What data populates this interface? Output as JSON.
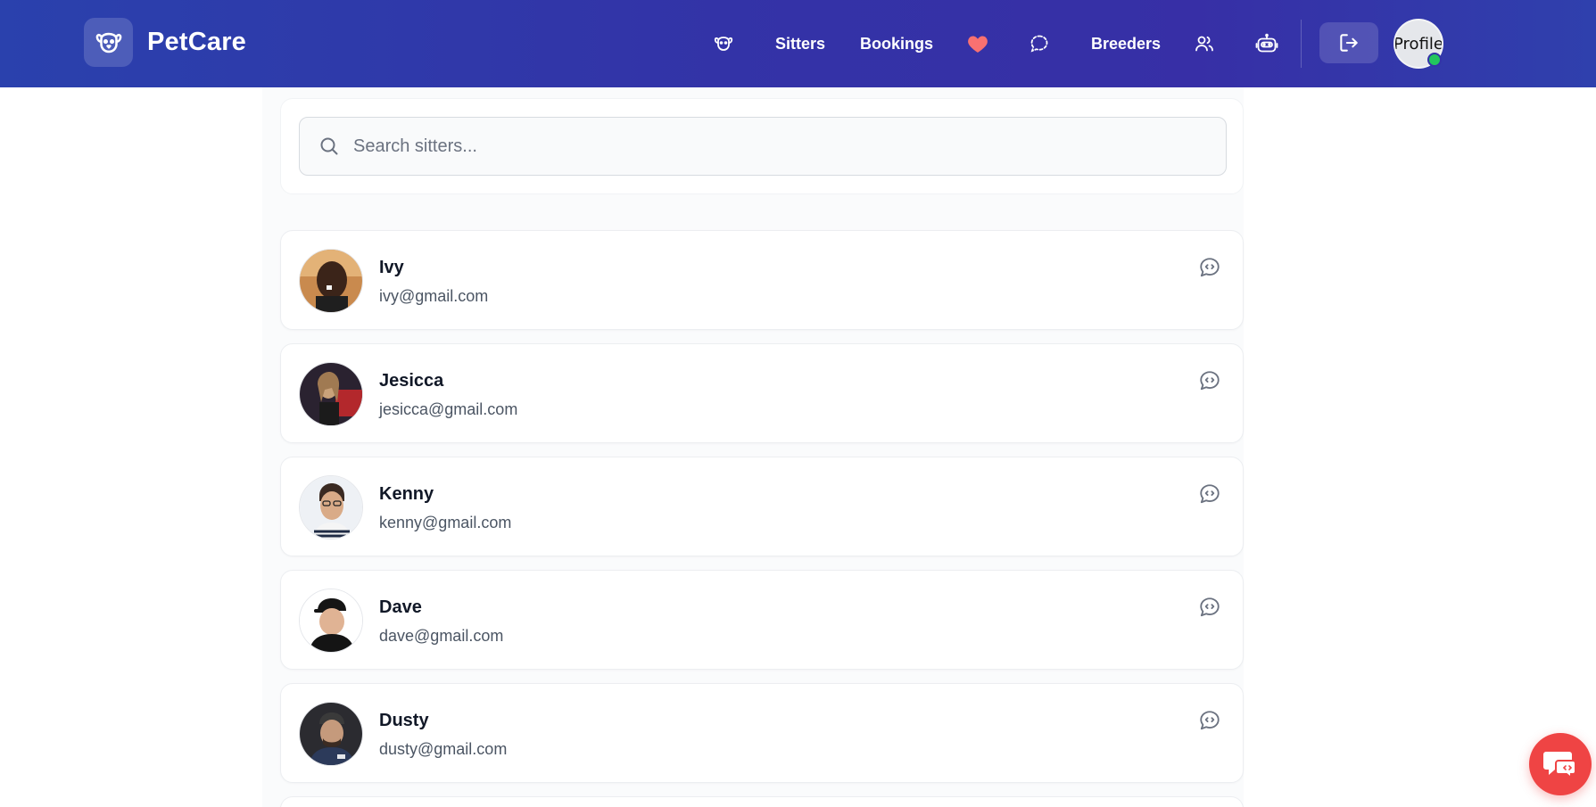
{
  "app": {
    "brand_name": "PetCare"
  },
  "nav": {
    "items": [
      {
        "type": "icon",
        "icon": "pet-face-icon"
      },
      {
        "type": "link",
        "label": "Sitters"
      },
      {
        "type": "link",
        "label": "Bookings"
      },
      {
        "type": "icon",
        "icon": "heart-icon",
        "color": "#f87171"
      },
      {
        "type": "icon",
        "icon": "chat-bubble-dashed-icon"
      },
      {
        "type": "link",
        "label": "Breeders"
      },
      {
        "type": "icon",
        "icon": "users-icon"
      },
      {
        "type": "icon",
        "icon": "robot-icon"
      }
    ],
    "logout_icon": "logout-icon",
    "profile_alt": "Profile",
    "online_status_color": "#22c55e"
  },
  "search": {
    "placeholder": "Search sitters..."
  },
  "sitters": [
    {
      "name": "Ivy",
      "email": "ivy@gmail.com"
    },
    {
      "name": "Jesicca",
      "email": "jesicca@gmail.com"
    },
    {
      "name": "Kenny",
      "email": "kenny@gmail.com"
    },
    {
      "name": "Dave",
      "email": "dave@gmail.com"
    },
    {
      "name": "Dusty",
      "email": "dusty@gmail.com"
    }
  ],
  "colors": {
    "header_gradient_start": "#2a41ad",
    "header_gradient_mid": "#372fa6",
    "fab": "#ef4444"
  }
}
